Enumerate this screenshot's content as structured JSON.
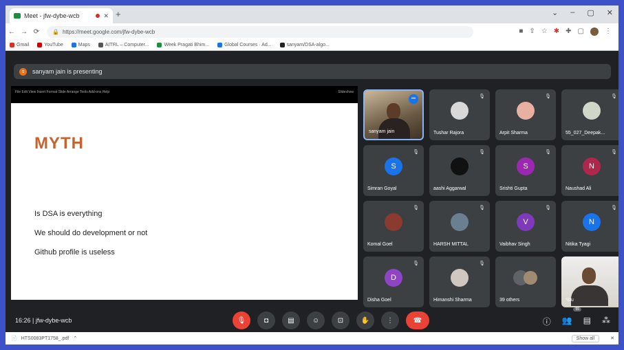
{
  "browser": {
    "tab_title": "Meet - jfw-dybe-wcb",
    "new_tab": "+",
    "window_controls": [
      "⌄",
      "–",
      "▢",
      "✕"
    ],
    "url": "https://meet.google.com/jfw-dybe-wcb",
    "bookmarks": [
      "Gmail",
      "YouTube",
      "Maps",
      "AITRL – Computer...",
      "Week Pragati Bhim...",
      "Global Courses · Ad...",
      "sanyam/DSA-algo..."
    ],
    "bookmark_colors": [
      "#d93025",
      "#cc0000",
      "#1a73e8",
      "#555555",
      "#1e8e3e",
      "#1a73e8",
      "#222222"
    ]
  },
  "meet": {
    "presenting_text": "sanyam jain is presenting",
    "presenter_initial": "s",
    "slide": {
      "title": "MYTH",
      "bullets": [
        "Is DSA is everything",
        "We should do development or not",
        "Github profile is useless"
      ],
      "app_menu": "File  Edit  View  Insert  Format  Slide  Arrange  Tools  Add-ons  Help",
      "toolbar_right": "Slideshow"
    },
    "participants": [
      {
        "name": "sanyam jain",
        "type": "camera"
      },
      {
        "name": "Tushar Rajora",
        "type": "photo",
        "color": "#d8d8d8"
      },
      {
        "name": "Arpit Sharma",
        "type": "photo",
        "color": "#e8b0a0"
      },
      {
        "name": "55_027_Deepak...",
        "type": "photo",
        "color": "#cfd8c8"
      },
      {
        "name": "Simran Goyal",
        "type": "letter",
        "letter": "S",
        "color": "#1a73e8"
      },
      {
        "name": "aashi Aggarwal",
        "type": "photo",
        "color": "#111111"
      },
      {
        "name": "Srishti Gupta",
        "type": "letter",
        "letter": "S",
        "color": "#9c27b0"
      },
      {
        "name": "Naushad Ali",
        "type": "letter",
        "letter": "N",
        "color": "#b0274d"
      },
      {
        "name": "Komal Goel",
        "type": "photo",
        "color": "#8a3a2e"
      },
      {
        "name": "HARSH MITTAL",
        "type": "photo",
        "color": "#6a8090"
      },
      {
        "name": "Vaibhav Singh",
        "type": "letter",
        "letter": "V",
        "color": "#7e3ab8"
      },
      {
        "name": "Nitika Tyagi",
        "type": "letter",
        "letter": "N",
        "color": "#1a73e8"
      },
      {
        "name": "Disha Goel",
        "type": "letter",
        "letter": "D",
        "color": "#8e44c4"
      },
      {
        "name": "Himanshi Sharma",
        "type": "photo",
        "color": "#d0c8c0"
      },
      {
        "name": "39 others",
        "type": "others"
      },
      {
        "name": "You",
        "type": "self"
      }
    ],
    "meeting_time": "16:26",
    "meeting_code": "jfw-dybe-wcb",
    "people_count": "55"
  },
  "download": {
    "file": "HTS0083PT1758_.pdf",
    "show_all": "Show all"
  }
}
